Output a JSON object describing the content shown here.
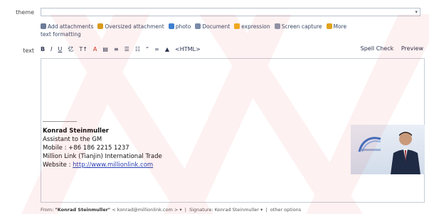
{
  "form": {
    "theme_label": "theme",
    "text_label": "text",
    "theme_value": ""
  },
  "attachments": {
    "items": [
      {
        "label": "Add attachments",
        "icon": "paperclip-icon",
        "color": "#6b7c99"
      },
      {
        "label": "Oversized attachment",
        "icon": "paperclip-icon",
        "color": "#d89a1c"
      },
      {
        "label": "photo",
        "icon": "image-icon",
        "color": "#3f7fd0"
      },
      {
        "label": "Document",
        "icon": "document-icon",
        "color": "#7a8aa8"
      },
      {
        "label": "expression",
        "icon": "smiley-icon",
        "color": "#f0b21e"
      },
      {
        "label": "Screen capture",
        "icon": "scissors-icon",
        "color": "#8c99ad"
      },
      {
        "label": "More",
        "icon": "more-icon",
        "color": "#e0a21b"
      }
    ],
    "second_line": "text formatting"
  },
  "toolbar": {
    "buttons": [
      "B",
      "I",
      "U",
      "亿",
      "T↑",
      "A",
      "▤",
      "≡",
      "☰",
      "☷",
      "“",
      "∞",
      "▲",
      "<HTML>"
    ],
    "spell_check": "Spell Check",
    "preview": "Preview"
  },
  "signature": {
    "name": "Konrad Steinmuller",
    "title": "Assistant to the GM",
    "mobile": "Mobile : +86 186 2215 1237",
    "company": "Million Link (Tianjin) International Trade",
    "website_label": "Website : ",
    "website_url": "http://www.millionlink.com"
  },
  "footer": {
    "from_prefix": "From:",
    "from_name": "\"Konrad Steinmuller\"",
    "from_email": "< konrad@millionlink.com >",
    "signature_label": "Signature: Konrad Steinmuller",
    "other_options": "other options"
  },
  "colors": {
    "accent": "#2a3fb2",
    "border": "#c6cdd7",
    "watermark": "#e02020"
  }
}
